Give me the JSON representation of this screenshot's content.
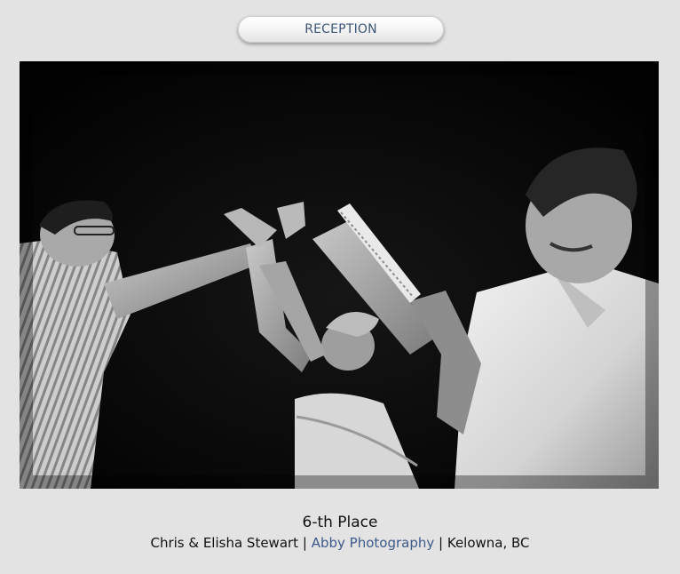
{
  "category": {
    "label": "RECEPTION"
  },
  "photo": {
    "alt": ""
  },
  "caption": {
    "place": "6-th Place",
    "couple": "Chris & Elisha Stewart",
    "separator": "|",
    "photographer": "Abby Photography",
    "location": "Kelowna, BC"
  },
  "colors": {
    "background": "#e3e3e3",
    "link": "#3d5a8a",
    "pill_text": "#3d5577"
  }
}
